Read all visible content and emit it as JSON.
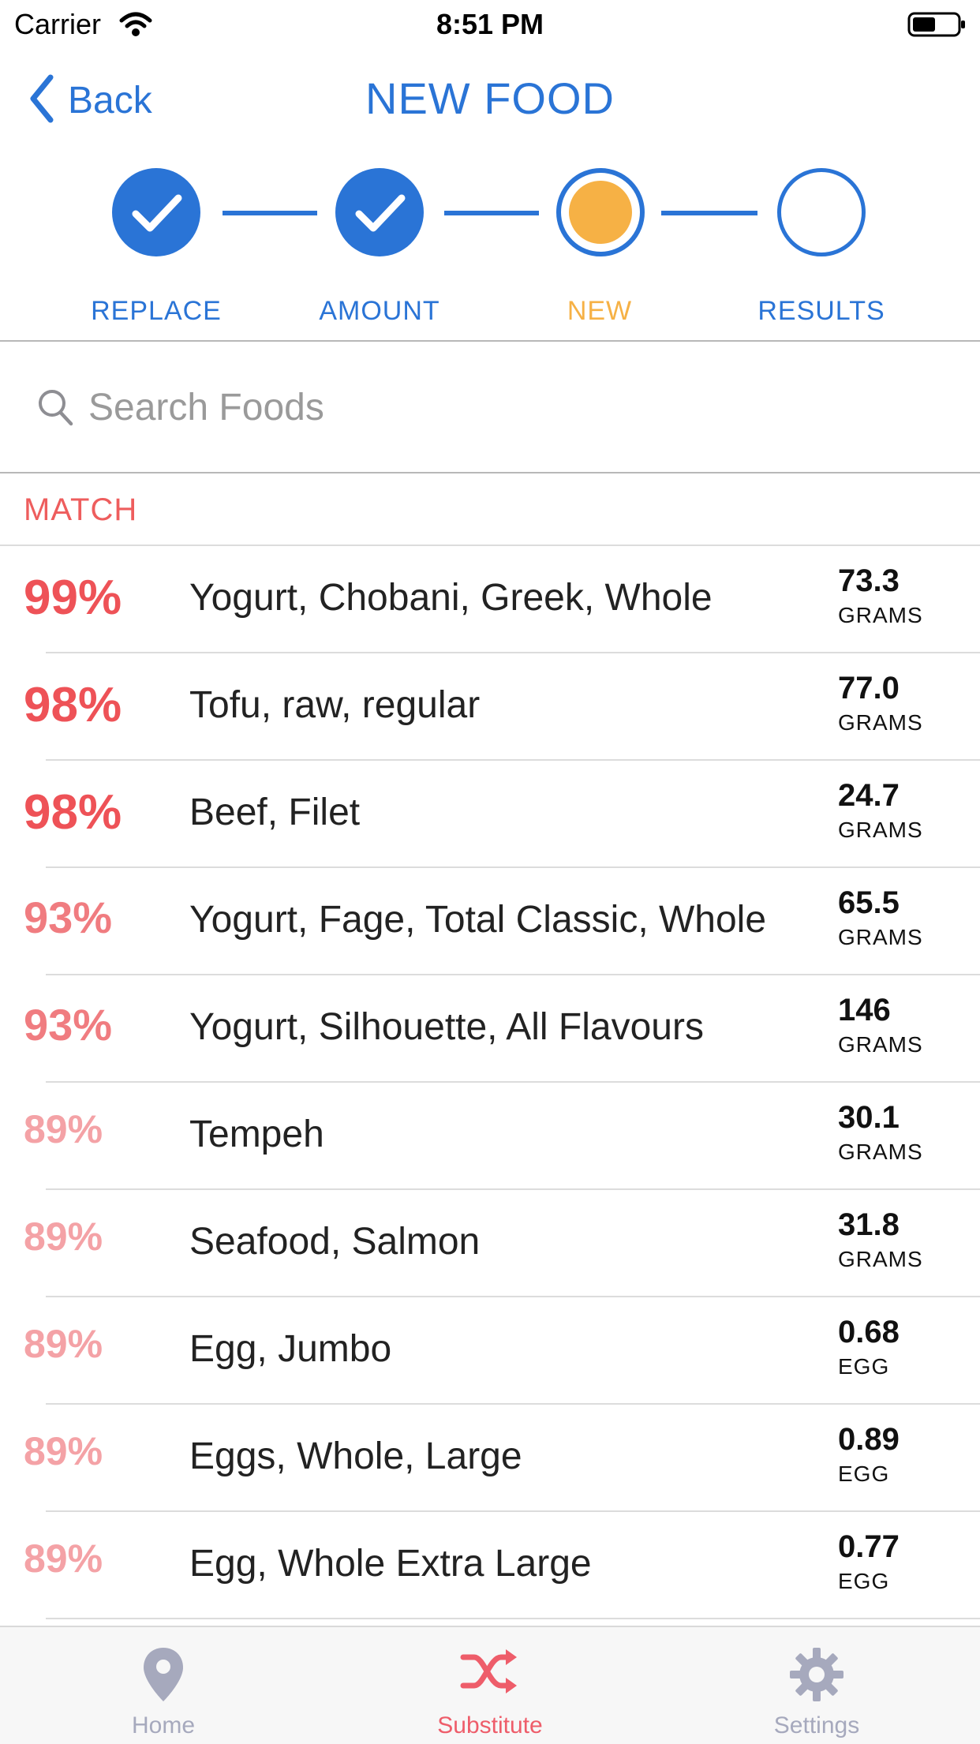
{
  "status_bar": {
    "carrier": "Carrier",
    "time": "8:51 PM"
  },
  "nav": {
    "back_label": "Back",
    "title": "NEW FOOD"
  },
  "stepper": {
    "steps": [
      {
        "label": "REPLACE",
        "state": "done"
      },
      {
        "label": "AMOUNT",
        "state": "done"
      },
      {
        "label": "NEW",
        "state": "current"
      },
      {
        "label": "RESULTS",
        "state": "todo"
      }
    ],
    "colors": {
      "active": "#2a74d6",
      "current": "#f6b145"
    }
  },
  "search": {
    "placeholder": "Search Foods",
    "value": ""
  },
  "section": {
    "title": "MATCH"
  },
  "results": [
    {
      "match": "99%",
      "name": "Yogurt, Chobani, Greek, Whole",
      "amount": "73.3",
      "unit": "GRAMS"
    },
    {
      "match": "98%",
      "name": "Tofu, raw, regular",
      "amount": "77.0",
      "unit": "GRAMS"
    },
    {
      "match": "98%",
      "name": "Beef, Filet",
      "amount": "24.7",
      "unit": "GRAMS"
    },
    {
      "match": "93%",
      "name": "Yogurt, Fage, Total Classic, Whole",
      "amount": "65.5",
      "unit": "GRAMS"
    },
    {
      "match": "93%",
      "name": "Yogurt, Silhouette, All Flavours",
      "amount": "146",
      "unit": "GRAMS"
    },
    {
      "match": "89%",
      "name": "Tempeh",
      "amount": "30.1",
      "unit": "GRAMS"
    },
    {
      "match": "89%",
      "name": "Seafood, Salmon",
      "amount": "31.8",
      "unit": "GRAMS"
    },
    {
      "match": "89%",
      "name": "Egg, Jumbo",
      "amount": "0.68",
      "unit": "EGG"
    },
    {
      "match": "89%",
      "name": "Eggs, Whole, Large",
      "amount": "0.89",
      "unit": "EGG"
    },
    {
      "match": "89%",
      "name": "Egg, Whole Extra Large",
      "amount": "0.77",
      "unit": "EGG"
    }
  ],
  "tabbar": {
    "tabs": [
      {
        "label": "Home",
        "icon": "location-pin-icon",
        "active": false
      },
      {
        "label": "Substitute",
        "icon": "shuffle-icon",
        "active": true
      },
      {
        "label": "Settings",
        "icon": "gear-icon",
        "active": false
      }
    ],
    "colors": {
      "active": "#ee5d6a",
      "inactive": "#a6a9bd"
    }
  }
}
